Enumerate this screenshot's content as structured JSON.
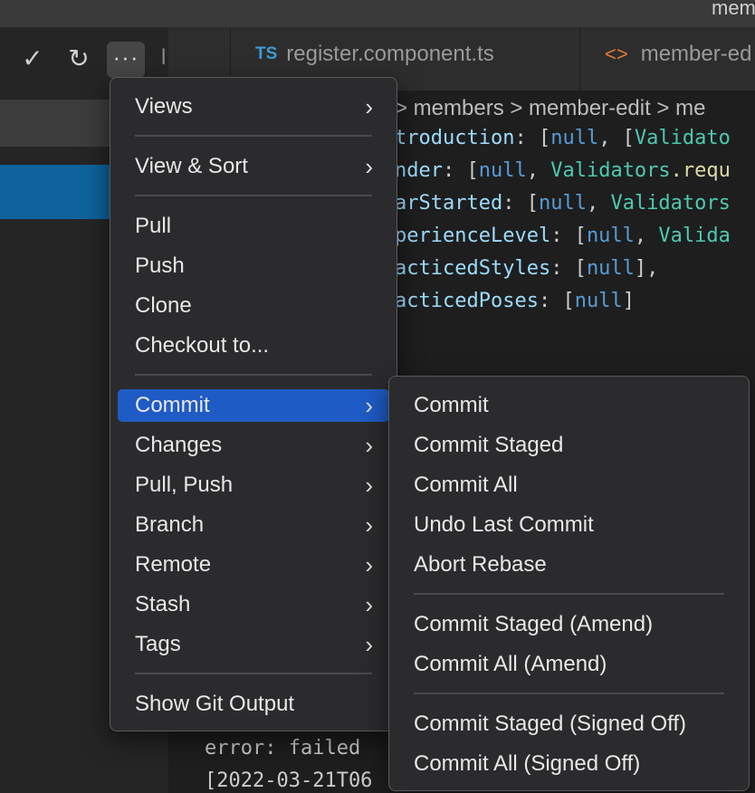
{
  "window": {
    "title": "mem"
  },
  "sidebar": {
    "actions": {
      "commit_icon": "check-icon",
      "refresh_icon": "refresh-icon",
      "more_icon": "more-icon",
      "truncated_text": "l"
    }
  },
  "tabs": [
    {
      "badge": "TS",
      "label": "register.component.ts"
    },
    {
      "badge": "<>",
      "label": "member-ed"
    }
  ],
  "breadcrumb": {
    "text": "> members > member-edit > me"
  },
  "code_lines": [
    {
      "prop": "troduction",
      "rest_open": ": [",
      "null": "null",
      "rest_mid": ", [",
      "cls": "Validato",
      "fn": "",
      "tail": ""
    },
    {
      "prop": "nder",
      "rest_open": ": [",
      "null": "null",
      "rest_mid": ", ",
      "cls": "Validators",
      "fn": ".requ",
      "tail": ""
    },
    {
      "prop": "arStarted",
      "rest_open": ": [",
      "null": "null",
      "rest_mid": ", ",
      "cls": "Validators",
      "fn": "",
      "tail": ""
    },
    {
      "prop": "perienceLevel",
      "rest_open": ": [",
      "null": "null",
      "rest_mid": ", ",
      "cls": "Valida",
      "fn": "",
      "tail": ""
    },
    {
      "prop": "acticedStyles",
      "rest_open": ": [",
      "null": "null",
      "rest_mid": "],",
      "cls": "",
      "fn": "",
      "tail": ""
    },
    {
      "prop": "acticedPoses",
      "rest_open": ": [",
      "null": "null",
      "rest_mid": "]",
      "cls": "",
      "fn": "",
      "tail": ""
    }
  ],
  "terminal": {
    "line1": "error: failed",
    "line2": "[2022-03-21T06"
  },
  "main_menu": {
    "items": [
      {
        "label": "Views",
        "submenu": true
      },
      {
        "label": "View & Sort",
        "submenu": true
      },
      {
        "label": "Pull",
        "submenu": false
      },
      {
        "label": "Push",
        "submenu": false
      },
      {
        "label": "Clone",
        "submenu": false
      },
      {
        "label": "Checkout to...",
        "submenu": false
      },
      {
        "label": "Commit",
        "submenu": true,
        "active": true
      },
      {
        "label": "Changes",
        "submenu": true
      },
      {
        "label": "Pull, Push",
        "submenu": true
      },
      {
        "label": "Branch",
        "submenu": true
      },
      {
        "label": "Remote",
        "submenu": true
      },
      {
        "label": "Stash",
        "submenu": true
      },
      {
        "label": "Tags",
        "submenu": true
      },
      {
        "label": "Show Git Output",
        "submenu": false
      }
    ]
  },
  "commit_submenu": {
    "items": [
      {
        "label": "Commit"
      },
      {
        "label": "Commit Staged"
      },
      {
        "label": "Commit All"
      },
      {
        "label": "Undo Last Commit"
      },
      {
        "label": "Abort Rebase"
      },
      {
        "label": "Commit Staged (Amend)"
      },
      {
        "label": "Commit All (Amend)"
      },
      {
        "label": "Commit Staged (Signed Off)"
      },
      {
        "label": "Commit All (Signed Off)"
      }
    ]
  },
  "colors": {
    "accent": "#1f5bc4",
    "selection": "#0e639c",
    "menu_bg": "#2b2b2d"
  }
}
